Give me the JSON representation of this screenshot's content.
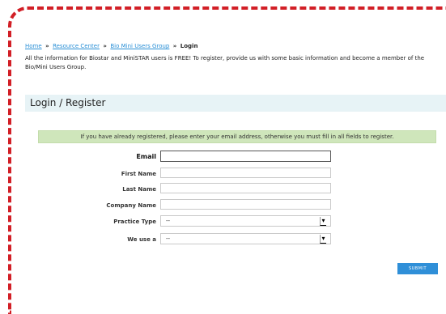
{
  "breadcrumb": {
    "items": [
      "Home",
      "Resource Center",
      "Bio Mini Users Group"
    ],
    "current": "Login",
    "separator": "»"
  },
  "intro_text": "All the information for Biostar and MiniSTAR users is FREE! To register, provide us with some basic information and become a member of the Bio/Mini Users Group.",
  "section_title": "Login / Register",
  "notice": "If you have already registered, please enter your email address, otherwise you must fill in all fields to register.",
  "form": {
    "email_label": "Email",
    "email_value": "",
    "first_name_label": "First Name",
    "first_name_value": "",
    "last_name_label": "Last Name",
    "last_name_value": "",
    "company_label": "Company Name",
    "company_value": "",
    "practice_type_label": "Practice Type",
    "practice_type_value": "--",
    "we_use_label": "We use a",
    "we_use_value": "--"
  },
  "submit_label": "SUBMIT",
  "colors": {
    "frame": "#d21f26",
    "link": "#2a8fd6",
    "section_bar": "#e7f3f6",
    "notice_bg": "#cfe6bb",
    "submit_bg": "#2f8fd8"
  }
}
